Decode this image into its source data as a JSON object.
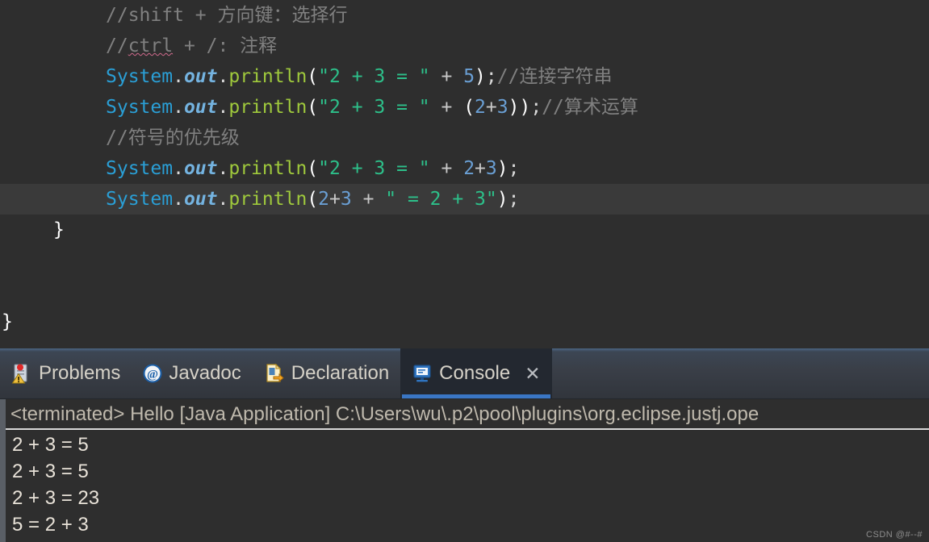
{
  "editor": {
    "lines": [
      {
        "indent": 2,
        "current": false,
        "tokens": [
          {
            "t": "comment",
            "v": "//shift + 方向键：选择行"
          }
        ]
      },
      {
        "indent": 2,
        "current": false,
        "tokens": [
          {
            "t": "comment",
            "v": "//"
          },
          {
            "t": "comment-spell",
            "v": "ctrl"
          },
          {
            "t": "comment",
            "v": " + /: 注释"
          }
        ]
      },
      {
        "indent": 2,
        "current": false,
        "tokens": [
          {
            "t": "class",
            "v": "System"
          },
          {
            "t": "punct",
            "v": "."
          },
          {
            "t": "field",
            "v": "out"
          },
          {
            "t": "punct",
            "v": "."
          },
          {
            "t": "method",
            "v": "println"
          },
          {
            "t": "brace",
            "v": "("
          },
          {
            "t": "string",
            "v": "\"2 + 3 = \""
          },
          {
            "t": "plain",
            "v": " + "
          },
          {
            "t": "num",
            "v": "5"
          },
          {
            "t": "brace",
            "v": ")"
          },
          {
            "t": "punct",
            "v": ";"
          },
          {
            "t": "comment",
            "v": "//连接字符串"
          }
        ]
      },
      {
        "indent": 2,
        "current": false,
        "tokens": [
          {
            "t": "class",
            "v": "System"
          },
          {
            "t": "punct",
            "v": "."
          },
          {
            "t": "field",
            "v": "out"
          },
          {
            "t": "punct",
            "v": "."
          },
          {
            "t": "method",
            "v": "println"
          },
          {
            "t": "brace",
            "v": "("
          },
          {
            "t": "string",
            "v": "\"2 + 3 = \""
          },
          {
            "t": "plain",
            "v": " + "
          },
          {
            "t": "brace",
            "v": "("
          },
          {
            "t": "num",
            "v": "2"
          },
          {
            "t": "plain",
            "v": "+"
          },
          {
            "t": "num",
            "v": "3"
          },
          {
            "t": "brace",
            "v": "))"
          },
          {
            "t": "punct",
            "v": ";"
          },
          {
            "t": "comment",
            "v": "//算术运算"
          }
        ]
      },
      {
        "indent": 2,
        "current": false,
        "tokens": [
          {
            "t": "comment",
            "v": "//符号的优先级"
          }
        ]
      },
      {
        "indent": 2,
        "current": false,
        "tokens": [
          {
            "t": "class",
            "v": "System"
          },
          {
            "t": "punct",
            "v": "."
          },
          {
            "t": "field",
            "v": "out"
          },
          {
            "t": "punct",
            "v": "."
          },
          {
            "t": "method",
            "v": "println"
          },
          {
            "t": "brace",
            "v": "("
          },
          {
            "t": "string",
            "v": "\"2 + 3 = \""
          },
          {
            "t": "plain",
            "v": " + "
          },
          {
            "t": "num",
            "v": "2"
          },
          {
            "t": "plain",
            "v": "+"
          },
          {
            "t": "num",
            "v": "3"
          },
          {
            "t": "brace",
            "v": ")"
          },
          {
            "t": "punct",
            "v": ";"
          }
        ]
      },
      {
        "indent": 2,
        "current": true,
        "tokens": [
          {
            "t": "class",
            "v": "System"
          },
          {
            "t": "punct",
            "v": "."
          },
          {
            "t": "field",
            "v": "out"
          },
          {
            "t": "punct",
            "v": "."
          },
          {
            "t": "method",
            "v": "println"
          },
          {
            "t": "brace",
            "v": "("
          },
          {
            "t": "num",
            "v": "2"
          },
          {
            "t": "plain",
            "v": "+"
          },
          {
            "t": "num",
            "v": "3"
          },
          {
            "t": "plain",
            "v": " + "
          },
          {
            "t": "string",
            "v": "\" = 2 + 3\""
          },
          {
            "t": "brace",
            "v": ")"
          },
          {
            "t": "punct",
            "v": ";"
          }
        ]
      },
      {
        "indent": 1,
        "current": false,
        "tokens": [
          {
            "t": "brace",
            "v": "}"
          }
        ]
      },
      {
        "indent": 0,
        "current": false,
        "tokens": []
      },
      {
        "indent": 0,
        "current": false,
        "tokens": []
      },
      {
        "indent": 0,
        "current": false,
        "tokens": [
          {
            "t": "brace",
            "v": "}"
          }
        ]
      }
    ]
  },
  "bottom_panel": {
    "tabs": [
      {
        "label": "Problems",
        "icon": "problems-icon",
        "active": false,
        "closable": false
      },
      {
        "label": "Javadoc",
        "icon": "javadoc-icon",
        "active": false,
        "closable": false
      },
      {
        "label": "Declaration",
        "icon": "declaration-icon",
        "active": false,
        "closable": false
      },
      {
        "label": "Console",
        "icon": "console-icon",
        "active": true,
        "closable": true,
        "close_glyph": "✕"
      }
    ],
    "console": {
      "terminated_line": "<terminated> Hello [Java Application] C:\\Users\\wu\\.p2\\pool\\plugins\\org.eclipse.justj.ope",
      "output": [
        "2 + 3 = 5",
        "2 + 3 = 5",
        "2 + 3 = 23",
        "5 = 2 + 3"
      ]
    }
  },
  "watermark": "CSDN @#--#",
  "colors": {
    "editor_bg": "#2e2e2e",
    "current_line_bg": "#3a3a3a",
    "comment": "#808080",
    "class": "#2a9fd6",
    "field": "#74b3e0",
    "method": "#9fc93c",
    "string": "#2dc08a",
    "number": "#6a9fd4",
    "tab_active_underline": "#3a76c4",
    "console_text": "#e8e2d8"
  }
}
